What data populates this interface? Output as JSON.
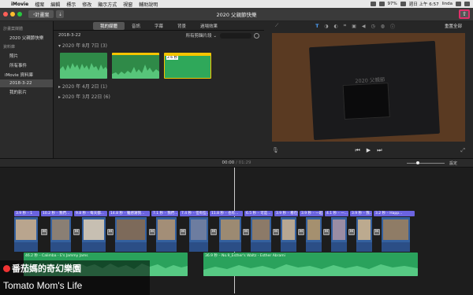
{
  "menubar": {
    "app": "iMovie",
    "items": [
      "檔案",
      "編輯",
      "標示",
      "修改",
      "顯示方式",
      "視窗",
      "輔助說明"
    ],
    "status": [
      "97%",
      "週日 上午 6:57",
      "linda"
    ]
  },
  "toolbar": {
    "back": "計畫案",
    "title": "2020 父親節快樂"
  },
  "sidebar": {
    "header1": "計畫案媒體",
    "project": "2020 父親節快樂",
    "header2": "資料庫",
    "items": [
      "照片",
      "所有事件",
      "iMovie 資料庫",
      "2018-3-22",
      "我的影片"
    ]
  },
  "browser": {
    "tabs": [
      "我的媒體",
      "音訊",
      "字幕",
      "背景",
      "過場效果"
    ],
    "date": "2018-3-22",
    "filter": "所有剪輯片段",
    "events": [
      {
        "label": "2020 年 8月 7日",
        "count": "(3)"
      },
      {
        "label": "2020 年 4月 2日",
        "count": "(1)"
      },
      {
        "label": "2020 年 3月 22日",
        "count": "(6)"
      }
    ],
    "clip_duration": "2.6 秒"
  },
  "viewer": {
    "reset": "重置全部",
    "book_title": "2020 父親節"
  },
  "timecode": {
    "current": "00:00",
    "sep": "/",
    "total": "01:29",
    "settings": "設定"
  },
  "timeline": {
    "titles": [
      "3.9 秒 – 1",
      "10.2 秒 – 我們...",
      "9.8 秒 – 每天都...",
      "14.8 秒 – 雖感謝我...",
      "7.1 秒 – 我們...",
      "7.4 秒 – 但有些...",
      "11.8 秒 – 也有...",
      "6.5 秒 – 可是...",
      "3.9 秒 – 看在你...",
      "3.9 秒 – 一起...",
      "4.1 秒 – 一...",
      "3.9 秒 – 我..",
      "3.2 秒 – Happ..."
    ],
    "audio": [
      {
        "label": "46.2 秒 – Calimba - E's Jammy Jams"
      },
      {
        "label": "36.9 秒 – No.9_Esther's Waltz - Esther Abrami"
      }
    ]
  },
  "watermark": {
    "line1": "番茄媽的奇幻樂園",
    "line2": "Tomato Mom's Life"
  }
}
